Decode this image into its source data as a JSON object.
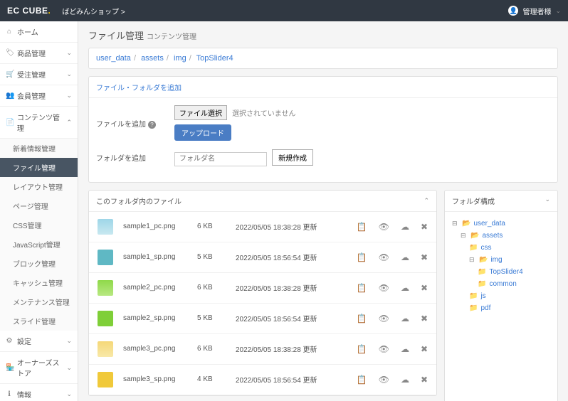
{
  "brand": "EC CUBE",
  "shop_name": "ばどみんショップ",
  "user_label": "管理者様",
  "sidebar": {
    "home": "ホーム",
    "product": "商品管理",
    "order": "受注管理",
    "member": "会員管理",
    "content": "コンテンツ管理",
    "content_subs": {
      "news": "新着情報管理",
      "file": "ファイル管理",
      "layout": "レイアウト管理",
      "page": "ページ管理",
      "css": "CSS管理",
      "js": "JavaScript管理",
      "block": "ブロック管理",
      "cache": "キャッシュ管理",
      "maint": "メンテナンス管理",
      "slide": "スライド管理"
    },
    "settings": "設定",
    "owners": "オーナーズストア",
    "info": "情報"
  },
  "page": {
    "title": "ファイル管理",
    "subtitle": "コンテンツ管理"
  },
  "breadcrumb": {
    "items": [
      "user_data",
      "assets",
      "img",
      "TopSlider4"
    ]
  },
  "add_section_head": "ファイル・フォルダを追加",
  "file_section": {
    "label": "ファイルを追加",
    "choose_btn": "ファイル選択",
    "nofile": "選択されていません",
    "upload_btn": "アップロード"
  },
  "folder_section": {
    "label": "フォルダを追加",
    "placeholder": "フォルダ名",
    "new_btn": "新規作成"
  },
  "files_head": "このフォルダ内のファイル",
  "files": [
    {
      "name": "sample1_pc.png",
      "size": "6 KB",
      "date": "2022/05/05 18:38:28 更新",
      "thumb": "thumb1"
    },
    {
      "name": "sample1_sp.png",
      "size": "5 KB",
      "date": "2022/05/05 18:56:54 更新",
      "thumb": "thumb2"
    },
    {
      "name": "sample2_pc.png",
      "size": "6 KB",
      "date": "2022/05/05 18:38:28 更新",
      "thumb": "thumb3"
    },
    {
      "name": "sample2_sp.png",
      "size": "5 KB",
      "date": "2022/05/05 18:56:54 更新",
      "thumb": "thumb4"
    },
    {
      "name": "sample3_pc.png",
      "size": "6 KB",
      "date": "2022/05/05 18:38:28 更新",
      "thumb": "thumb5"
    },
    {
      "name": "sample3_sp.png",
      "size": "4 KB",
      "date": "2022/05/05 18:56:54 更新",
      "thumb": "thumb6"
    }
  ],
  "tree": {
    "head": "フォルダ構成",
    "root": "user_data",
    "assets": "assets",
    "css": "css",
    "img": "img",
    "topslider": "TopSlider4",
    "common": "common",
    "js": "js",
    "pdf": "pdf"
  }
}
